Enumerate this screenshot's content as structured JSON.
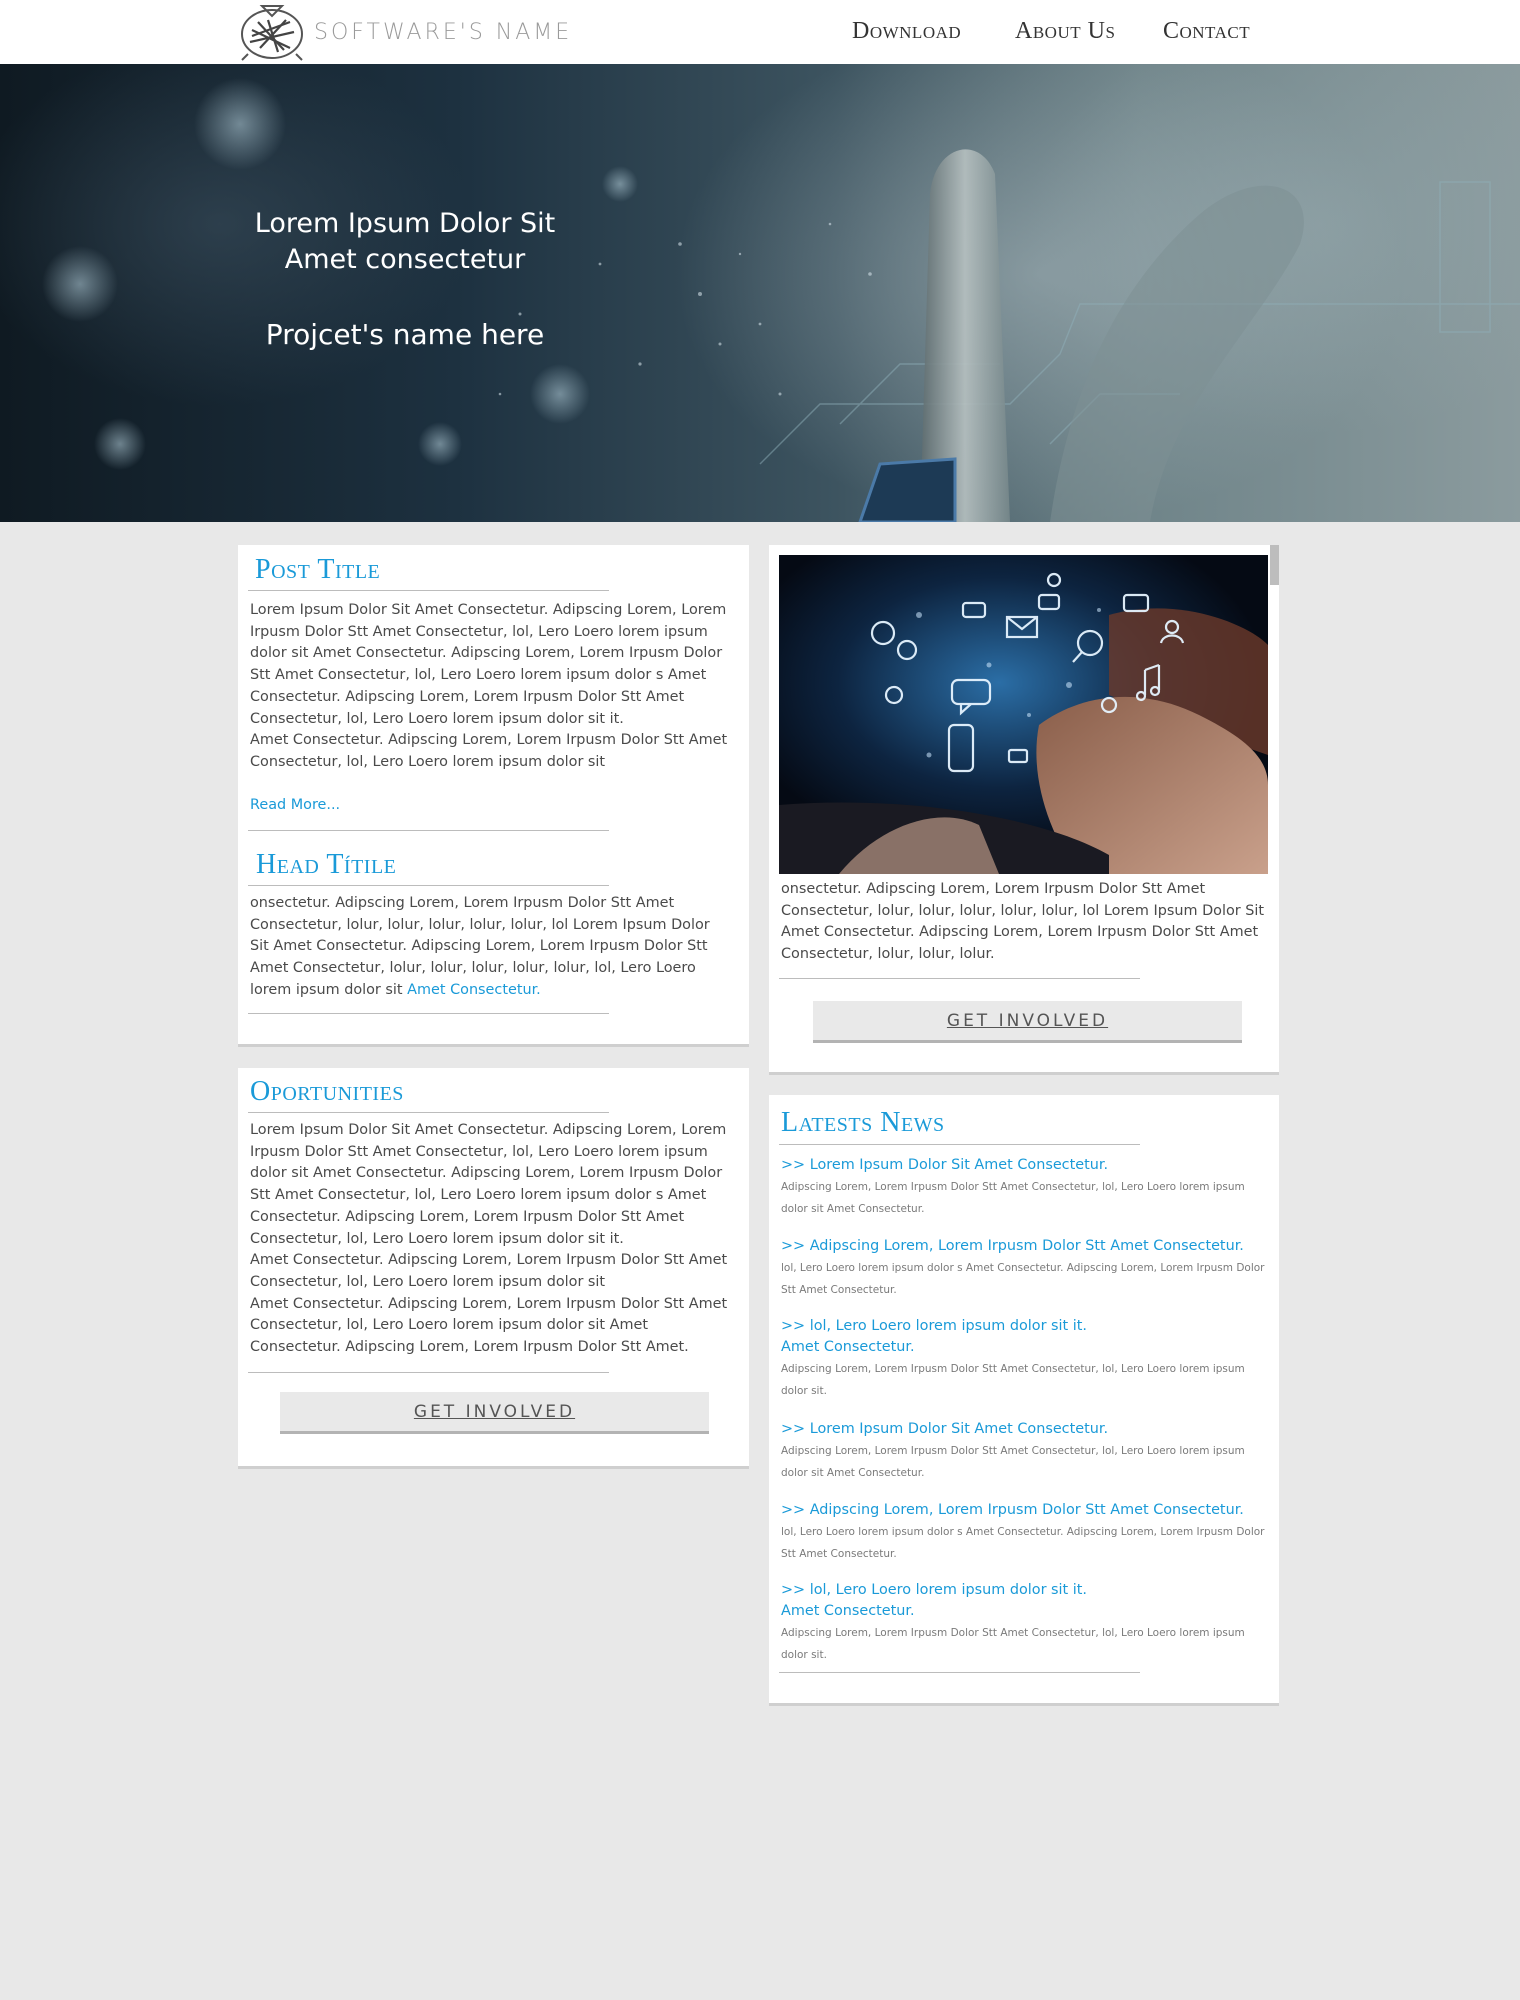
{
  "header": {
    "brand": "SOFTWARE'S NAME",
    "nav": [
      "Download",
      "About Us",
      "Contact"
    ]
  },
  "hero": {
    "line1": "Lorem Ipsum Dolor Sit",
    "line2": "Amet consectetur",
    "project": "Projcet's name here"
  },
  "post": {
    "title": "Post Title",
    "body": "Lorem Ipsum Dolor Sit Amet Consectetur. Adipscing Lorem, Lorem Irpusm Dolor Stt Amet Consectetur, lol, Lero Loero lorem ipsum dolor sit Amet Consectetur. Adipscing Lorem, Lorem Irpusm Dolor Stt Amet Consectetur, lol, Lero Loero lorem ipsum dolor s Amet Consectetur. Adipscing Lorem, Lorem Irpusm Dolor Stt Amet Consectetur, lol, Lero Loero lorem ipsum dolor sit it.",
    "body2": "Amet Consectetur. Adipscing Lorem, Lorem Irpusm Dolor Stt Amet Consectetur, lol, Lero Loero lorem ipsum dolor sit",
    "read_more": "Read More..."
  },
  "head": {
    "title": "Head Títile",
    "body": "onsectetur. Adipscing Lorem, Lorem Irpusm Dolor Stt Amet Consectetur, lolur, lolur, lolur, lolur, lolur, lol Lorem Ipsum Dolor Sit Amet Consectetur. Adipscing Lorem, Lorem Irpusm Dolor Stt Amet Consectetur, lolur, lolur, lolur, lolur, lolur, lol, Lero Loero lorem ipsum dolor sit",
    "link": "Amet Consectetur."
  },
  "opportunities": {
    "title": "Oportunities",
    "body": "Lorem Ipsum Dolor Sit Amet Consectetur. Adipscing Lorem, Lorem Irpusm Dolor Stt Amet Consectetur, lol, Lero Loero lorem ipsum dolor sit Amet Consectetur. Adipscing Lorem, Lorem Irpusm Dolor Stt Amet Consectetur, lol, Lero Loero lorem ipsum dolor s Amet Consectetur. Adipscing Lorem, Lorem Irpusm Dolor Stt Amet Consectetur, lol, Lero Loero lorem ipsum dolor sit it.",
    "body2": "Amet Consectetur. Adipscing Lorem, Lorem Irpusm Dolor Stt Amet Consectetur, lol, Lero Loero lorem ipsum dolor sit",
    "body3": "Amet Consectetur. Adipscing Lorem, Lorem Irpusm Dolor Stt Amet Consectetur, lol, Lero Loero lorem ipsum dolor sit  Amet Consectetur. Adipscing Lorem, Lorem Irpusm Dolor Stt Amet.",
    "button": "GET INVOLVED"
  },
  "feature": {
    "body": "onsectetur. Adipscing Lorem, Lorem Irpusm Dolor Stt Amet Consectetur, lolur, lolur, lolur, lolur, lolur, lol Lorem Ipsum Dolor Sit Amet Consectetur. Adipscing Lorem, Lorem Irpusm Dolor Stt Amet Consectetur, lolur, lolur, lolur.",
    "button": "GET INVOLVED"
  },
  "news": {
    "title": "Latests News",
    "items": [
      {
        "title": ">> Lorem Ipsum Dolor Sit Amet Consectetur.",
        "desc": "Adipscing Lorem, Lorem Irpusm Dolor Stt Amet Consectetur, lol, Lero Loero lorem ipsum dolor sit Amet Consectetur."
      },
      {
        "title": ">> Adipscing Lorem, Lorem Irpusm Dolor Stt Amet Consectetur.",
        "desc": "lol, Lero Loero lorem ipsum dolor s Amet Consectetur. Adipscing Lorem, Lorem Irpusm Dolor Stt Amet Consectetur."
      },
      {
        "title": ">> lol, Lero Loero lorem ipsum dolor sit it. Amet Consectetur.",
        "desc": "Adipscing Lorem, Lorem Irpusm Dolor Stt Amet Consectetur, lol, Lero Loero lorem ipsum dolor sit."
      },
      {
        "title": ">> Lorem Ipsum Dolor Sit Amet Consectetur.",
        "desc": "Adipscing Lorem, Lorem Irpusm Dolor Stt Amet Consectetur, lol, Lero Loero lorem ipsum dolor sit Amet Consectetur."
      },
      {
        "title": ">> Adipscing Lorem, Lorem Irpusm Dolor Stt Amet Consectetur.",
        "desc": "lol, Lero Loero lorem ipsum dolor s Amet Consectetur. Adipscing Lorem, Lorem Irpusm Dolor Stt Amet Consectetur."
      },
      {
        "title": ">> lol, Lero Loero lorem ipsum dolor sit it. Amet Consectetur.",
        "desc": "Adipscing Lorem, Lorem Irpusm Dolor Stt Amet Consectetur, lol, Lero Loero lorem ipsum dolor sit."
      }
    ]
  },
  "colors": {
    "accent": "#1a9ad8",
    "page_bg": "#e8e8e8",
    "card_bg": "#ffffff",
    "button_bg": "#e9e9e9"
  },
  "icons": [
    "logo-emblem-icon",
    "mail-icon",
    "chat-icon",
    "music-icon",
    "search-icon",
    "phone-icon",
    "user-icon"
  ]
}
